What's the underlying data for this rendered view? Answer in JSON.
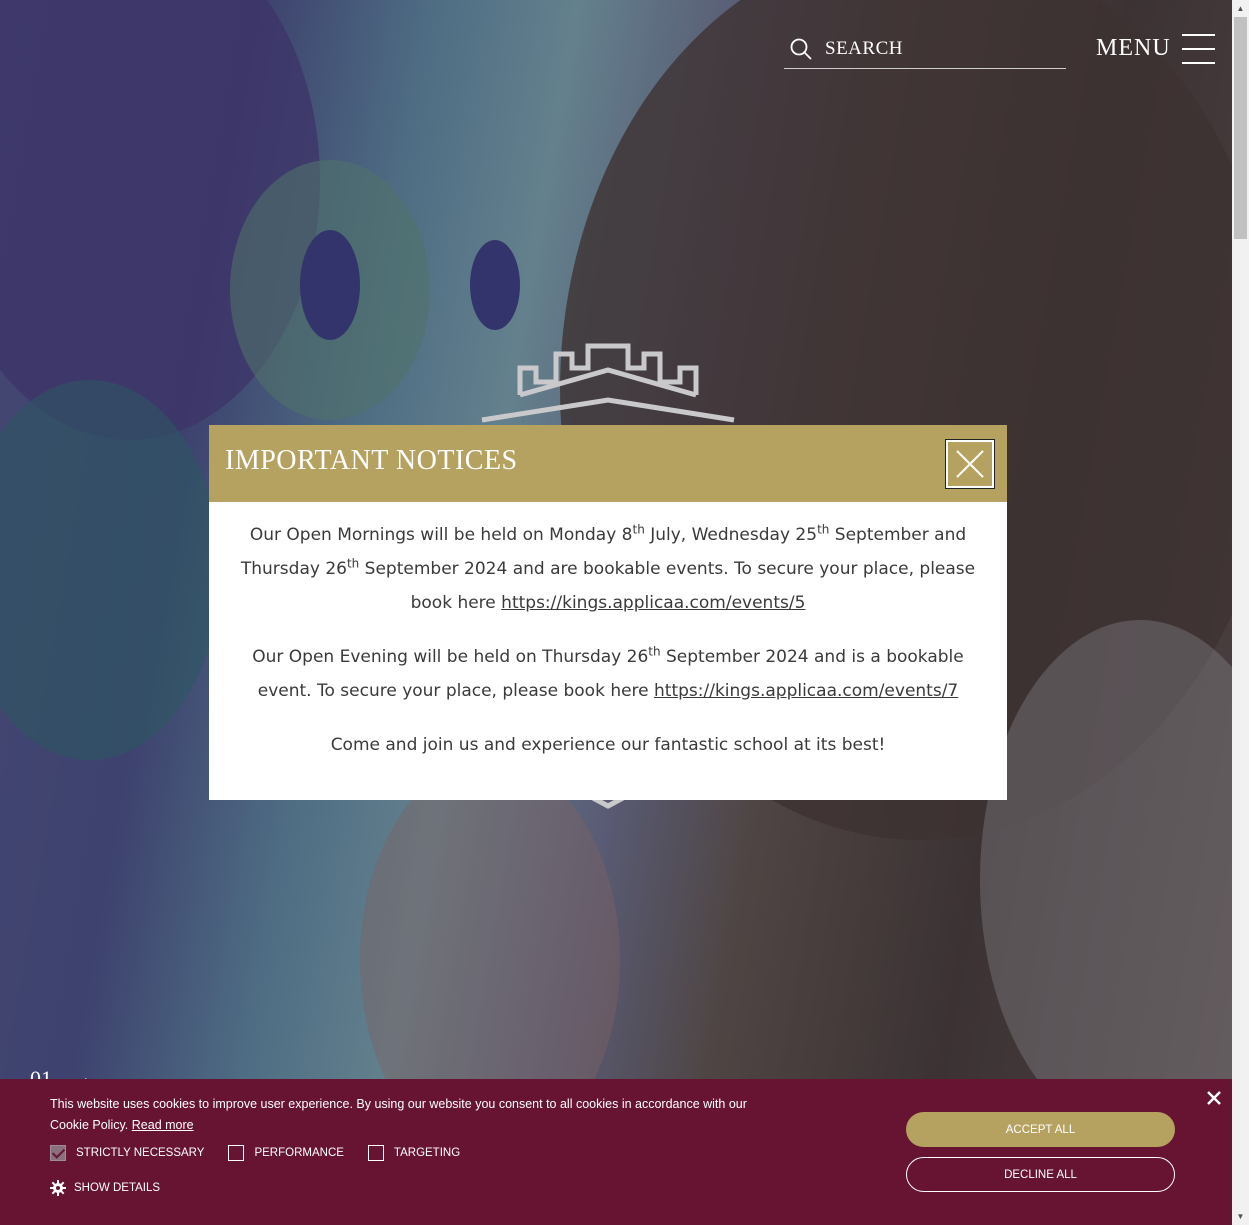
{
  "header": {
    "search_placeholder": "SEARCH",
    "menu_label": "MENU"
  },
  "hero": {
    "slide_number": "01",
    "next_arrow": "→"
  },
  "modal": {
    "title": "IMPORTANT NOTICES",
    "paragraph1": {
      "part1": "Our Open Mornings will be held on Monday 8",
      "sup1": "th",
      "part2": " July, Wednesday 25",
      "sup2": "th",
      "part3": " September and Thursday 26",
      "sup3": "th",
      "part4": " September 2024 and are bookable events. To secure your place, please book here ",
      "link": "https://kings.applicaa.com/events/5"
    },
    "paragraph2": {
      "part1": "Our Open Evening will be held on Thursday 26",
      "sup1": "th",
      "part2": " September 2024 and is a bookable event. To secure your place, please book here ",
      "link": "https://kings.applicaa.com/events/7"
    },
    "paragraph3": "Come and join us and experience our fantastic school at its best!"
  },
  "cookie": {
    "text": "This website uses cookies to improve user experience. By using our website you consent to all cookies in accordance with our Cookie Policy.",
    "read_more": "Read more",
    "options": [
      {
        "label": "STRICTLY NECESSARY",
        "checked": true
      },
      {
        "label": "PERFORMANCE",
        "checked": false
      },
      {
        "label": "TARGETING",
        "checked": false
      }
    ],
    "show_details": "SHOW DETAILS",
    "accept_all": "ACCEPT ALL",
    "decline_all": "DECLINE ALL"
  },
  "colors": {
    "modal_header": "#b5a160",
    "cookie_banner": "#661432",
    "accept_button": "#b5a160"
  }
}
